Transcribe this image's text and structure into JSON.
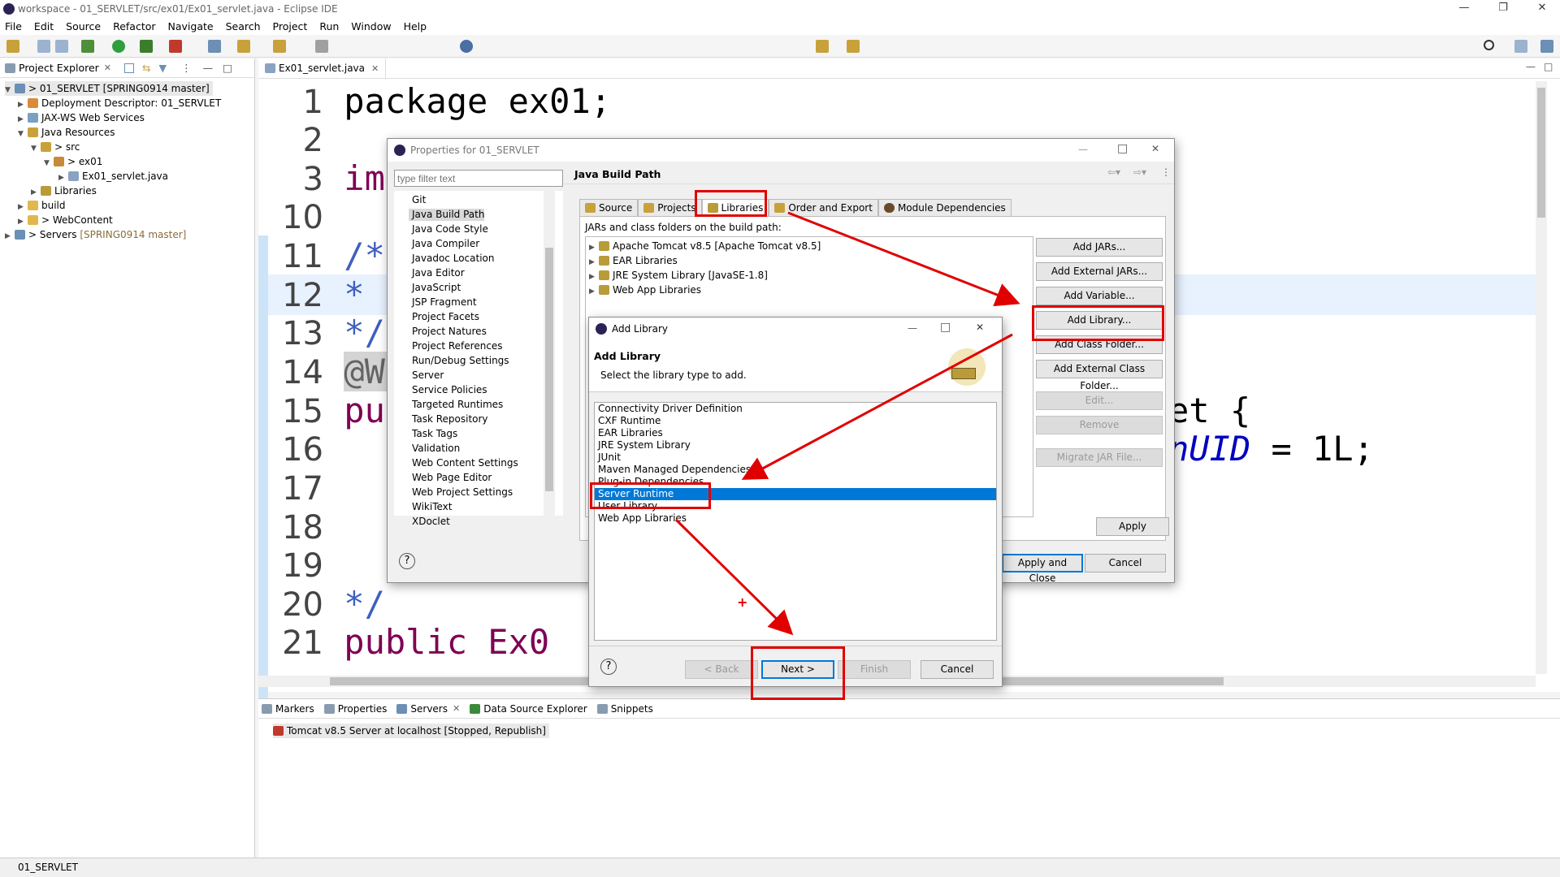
{
  "window": {
    "title": "workspace - 01_SERVLET/src/ex01/Ex01_servlet.java - Eclipse IDE"
  },
  "menu": [
    "File",
    "Edit",
    "Source",
    "Refactor",
    "Navigate",
    "Search",
    "Project",
    "Run",
    "Window",
    "Help"
  ],
  "explorer": {
    "tab_label": "Project Explorer",
    "rows": [
      {
        "label": "> 01_SERVLET [SPRING0914 master]",
        "extra": ""
      },
      {
        "label": "Deployment Descriptor: 01_SERVLET",
        "extra": ""
      },
      {
        "label": "JAX-WS Web Services",
        "extra": ""
      },
      {
        "label": "Java Resources",
        "extra": ""
      },
      {
        "label": "> src",
        "extra": ""
      },
      {
        "label": "> ex01",
        "extra": ""
      },
      {
        "label": "Ex01_servlet.java",
        "extra": ""
      },
      {
        "label": "Libraries",
        "extra": ""
      },
      {
        "label": "build",
        "extra": ""
      },
      {
        "label": "> WebContent",
        "extra": ""
      },
      {
        "label": "> Servers",
        "extra": "[SPRING0914 master]"
      }
    ]
  },
  "editor": {
    "tab_label": "Ex01_servlet.java",
    "lines": [
      {
        "n": "1",
        "code": "package ex01;"
      },
      {
        "n": "2",
        "code": ""
      },
      {
        "n": "3",
        "code": "impo"
      },
      {
        "n": "10",
        "code": ""
      },
      {
        "n": "11",
        "code": "/**"
      },
      {
        "n": "12",
        "code": " * S"
      },
      {
        "n": "13",
        "code": " */"
      },
      {
        "n": "14",
        "code": "@Web"
      },
      {
        "n": "15",
        "code": "publ"
      },
      {
        "n": "16",
        "code": ""
      },
      {
        "n": "17",
        "code": ""
      },
      {
        "n": "18",
        "code": ""
      },
      {
        "n": "19",
        "code": ""
      },
      {
        "n": "20",
        "code": "    */"
      },
      {
        "n": "21",
        "code": "    public Ex0"
      }
    ],
    "right_fragments": {
      "line15": "et {",
      "line16_a": "nUID",
      "line16_b": " = 1L;"
    }
  },
  "bottom": {
    "tabs": [
      "Markers",
      "Properties",
      "Servers",
      "Data Source Explorer",
      "Snippets"
    ],
    "server_row": "Tomcat v8.5 Server at localhost  [Stopped, Republish]"
  },
  "status": {
    "text": "01_SERVLET"
  },
  "properties_dialog": {
    "title": "Properties for 01_SERVLET",
    "filter_placeholder": "type filter text",
    "page_title": "Java Build Path",
    "tree": [
      "Git",
      "Java Build Path",
      "Java Code Style",
      "Java Compiler",
      "Javadoc Location",
      "Java Editor",
      "JavaScript",
      "JSP Fragment",
      "Project Facets",
      "Project Natures",
      "Project References",
      "Run/Debug Settings",
      "Server",
      "Service Policies",
      "Targeted Runtimes",
      "Task Repository",
      "Task Tags",
      "Validation",
      "Web Content Settings",
      "Web Page Editor",
      "Web Project Settings",
      "WikiText",
      "XDoclet"
    ],
    "tabs": [
      "Source",
      "Projects",
      "Libraries",
      "Order and Export",
      "Module Dependencies"
    ],
    "jar_label": "JARs and class folders on the build path:",
    "jars": [
      "Apache Tomcat v8.5 [Apache Tomcat v8.5]",
      "EAR Libraries",
      "JRE System Library [JavaSE-1.8]",
      "Web App Libraries"
    ],
    "buttons": [
      "Add JARs...",
      "Add External JARs...",
      "Add Variable...",
      "Add Library...",
      "Add Class Folder...",
      "Add External Class Folder...",
      "Edit...",
      "Remove",
      "Migrate JAR File..."
    ],
    "apply": "Apply",
    "apply_close": "Apply and Close",
    "cancel": "Cancel"
  },
  "add_library_dialog": {
    "title": "Add Library",
    "heading": "Add Library",
    "subtitle": "Select the library type to add.",
    "items": [
      "Connectivity Driver Definition",
      "CXF Runtime",
      "EAR Libraries",
      "JRE System Library",
      "JUnit",
      "Maven Managed Dependencies",
      "Plug-in Dependencies",
      "Server Runtime",
      "User Library",
      "Web App Libraries"
    ],
    "selected": "Server Runtime",
    "back": "< Back",
    "next": "Next >",
    "finish": "Finish",
    "cancel": "Cancel"
  },
  "colors": {
    "annotation_red": "#e00000",
    "selection_blue": "#0078d7",
    "keyword": "#7f0055"
  }
}
